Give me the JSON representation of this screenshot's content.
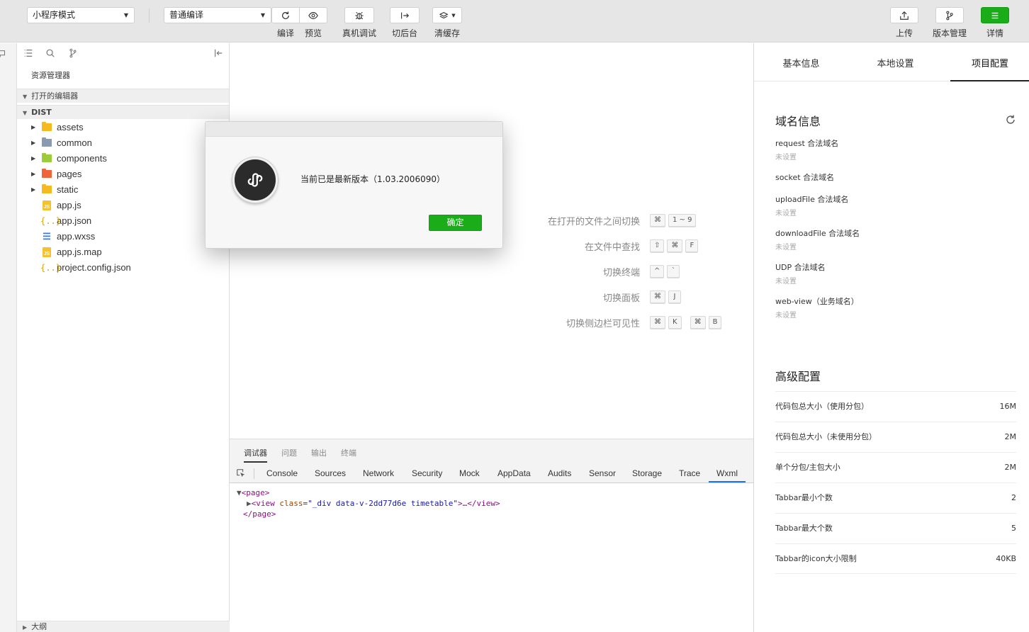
{
  "toolbar": {
    "mode_select": "小程序模式",
    "compile_select": "普通编译",
    "compile_label": "编译",
    "preview_label": "预览",
    "debug_label": "真机调试",
    "background_label": "切后台",
    "cache_label": "清缓存",
    "upload_label": "上传",
    "version_label": "版本管理",
    "details_label": "详情"
  },
  "explorer": {
    "title": "资源管理器",
    "open_editors": "打开的编辑器",
    "root": "DIST",
    "items": [
      {
        "name": "assets",
        "type": "folder",
        "color": "#f5b921"
      },
      {
        "name": "common",
        "type": "folder",
        "color": "#8a9bb0"
      },
      {
        "name": "components",
        "type": "folder",
        "color": "#9ccc3a"
      },
      {
        "name": "pages",
        "type": "folder",
        "color": "#f0643c"
      },
      {
        "name": "static",
        "type": "folder",
        "color": "#f5b921"
      },
      {
        "name": "app.js",
        "type": "js"
      },
      {
        "name": "app.json",
        "type": "json"
      },
      {
        "name": "app.wxss",
        "type": "css"
      },
      {
        "name": "app.js.map",
        "type": "map"
      },
      {
        "name": "project.config.json",
        "type": "json"
      }
    ],
    "outline": "大纲"
  },
  "editor": {
    "shortcuts": [
      {
        "label": "在打开的文件之间切换",
        "keys": [
          [
            "⌘",
            "1 ~ 9"
          ]
        ]
      },
      {
        "label": "在文件中查找",
        "keys": [
          [
            "⇧",
            "⌘",
            "F"
          ]
        ]
      },
      {
        "label": "切换终端",
        "keys": [
          [
            "^",
            "`"
          ]
        ]
      },
      {
        "label": "切换面板",
        "keys": [
          [
            "⌘",
            "J"
          ]
        ]
      },
      {
        "label": "切换侧边栏可见性",
        "keys": [
          [
            "⌘",
            "K"
          ],
          [
            "⌘",
            "B"
          ]
        ]
      }
    ]
  },
  "debugger": {
    "tabs": [
      "调试器",
      "问题",
      "输出",
      "终端"
    ],
    "panels": [
      "Console",
      "Sources",
      "Network",
      "Security",
      "Mock",
      "AppData",
      "Audits",
      "Sensor",
      "Storage",
      "Trace",
      "Wxml"
    ],
    "active_panel": "Wxml",
    "code": {
      "page_open": "<page>",
      "view_tag": "<view",
      "attr_name": "class",
      "attr_value": "\"_div data-v-2dd77d6e timetable\"",
      "view_rest": ">…</view>",
      "page_close": "</page>"
    }
  },
  "rightpanel": {
    "tabs": [
      "基本信息",
      "本地设置",
      "项目配置"
    ],
    "active_tab": "项目配置",
    "domain_title": "域名信息",
    "domains": [
      {
        "label": "request 合法域名",
        "value": "未设置"
      },
      {
        "label": "socket 合法域名",
        "value": ""
      },
      {
        "label": "uploadFile 合法域名",
        "value": "未设置"
      },
      {
        "label": "downloadFile 合法域名",
        "value": "未设置"
      },
      {
        "label": "UDP 合法域名",
        "value": "未设置"
      },
      {
        "label": "web-view（业务域名）",
        "value": "未设置"
      }
    ],
    "advanced_title": "高级配置",
    "configs": [
      {
        "label": "代码包总大小（使用分包）",
        "value": "16M"
      },
      {
        "label": "代码包总大小（未使用分包）",
        "value": "2M"
      },
      {
        "label": "单个分包/主包大小",
        "value": "2M"
      },
      {
        "label": "Tabbar最小个数",
        "value": "2"
      },
      {
        "label": "Tabbar最大个数",
        "value": "5"
      },
      {
        "label": "Tabbar的icon大小限制",
        "value": "40KB"
      }
    ]
  },
  "dialog": {
    "message": "当前已是最新版本（1.03.2006090）",
    "ok_label": "确定"
  },
  "colors": {
    "accent_green": "#1aad19",
    "tab_active_blue": "#1a73e8"
  }
}
